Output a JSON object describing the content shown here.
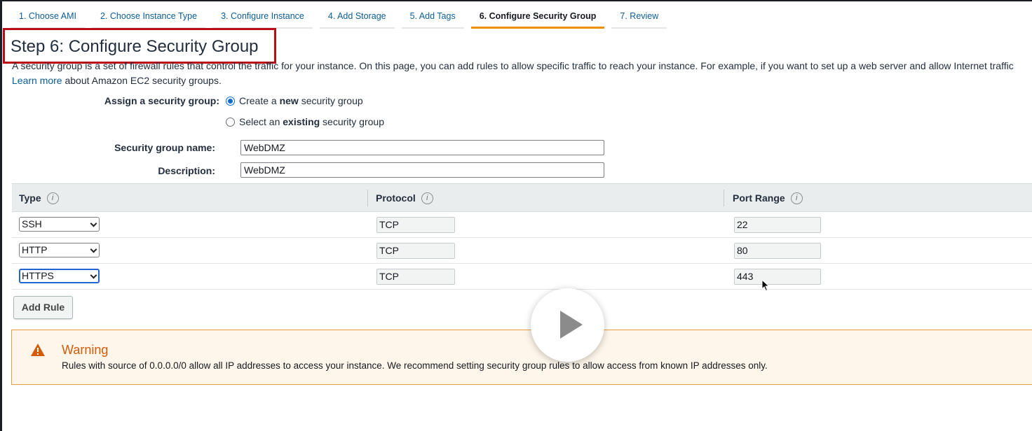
{
  "wizard": {
    "steps": [
      {
        "label": "1. Choose AMI"
      },
      {
        "label": "2. Choose Instance Type"
      },
      {
        "label": "3. Configure Instance"
      },
      {
        "label": "4. Add Storage"
      },
      {
        "label": "5. Add Tags"
      },
      {
        "label": "6. Configure Security Group"
      },
      {
        "label": "7. Review"
      }
    ],
    "active_step": 6
  },
  "page": {
    "title": "Step 6: Configure Security Group",
    "intro_text": "A security group is a set of firewall rules that control the traffic for your instance. On this page, you can add rules to allow specific traffic to reach your instance. For example, if you want to set up a web server and allow Internet traffic",
    "learn_more_link": "Learn more",
    "learn_more_suffix": "about Amazon EC2 security groups."
  },
  "form": {
    "assign_label": "Assign a security group:",
    "option_new": {
      "prefix": "Create a ",
      "bold": "new",
      "suffix": " security group",
      "selected": true
    },
    "option_existing": {
      "prefix": "Select an ",
      "bold": "existing",
      "suffix": " security group",
      "selected": false
    },
    "name_label": "Security group name:",
    "name_value": "WebDMZ",
    "description_label": "Description:",
    "description_value": "WebDMZ"
  },
  "rules_table": {
    "headers": {
      "type": "Type",
      "protocol": "Protocol",
      "port_range": "Port Range"
    },
    "info_icon": "i",
    "rows": [
      {
        "type": "SSH",
        "protocol": "TCP",
        "port_range": "22"
      },
      {
        "type": "HTTP",
        "protocol": "TCP",
        "port_range": "80"
      },
      {
        "type": "HTTPS",
        "protocol": "TCP",
        "port_range": "443"
      }
    ],
    "add_rule_label": "Add Rule"
  },
  "warning": {
    "icon": "warning-triangle-icon",
    "title": "Warning",
    "text": "Rules with source of 0.0.0.0/0 allow all IP addresses to access your instance. We recommend setting security group rules to allow access from known IP addresses only."
  },
  "overlay": {
    "icon": "play-icon"
  },
  "colors": {
    "link": "#0b5d99",
    "active_tab_underline": "#ec9000",
    "highlight_box": "#b80d15",
    "warning_title": "#d45b07",
    "warning_border": "#ec9c3c",
    "warning_bg": "#fef6ea"
  }
}
